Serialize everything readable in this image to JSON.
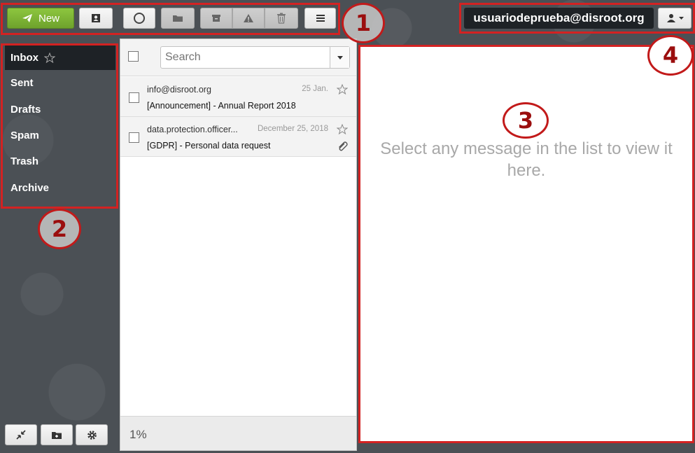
{
  "toolbar": {
    "new_label": "New"
  },
  "account": {
    "email": "usuariodeprueba@disroot.org"
  },
  "folders": [
    {
      "label": "Inbox",
      "active": true
    },
    {
      "label": "Sent"
    },
    {
      "label": "Drafts"
    },
    {
      "label": "Spam"
    },
    {
      "label": "Trash"
    },
    {
      "label": "Archive"
    }
  ],
  "search": {
    "placeholder": "Search"
  },
  "messages": [
    {
      "from": "info@disroot.org",
      "date": "25 Jan.",
      "subject": "[Announcement] - Annual Report 2018",
      "attachment": false
    },
    {
      "from": "data.protection.officer...",
      "date": "December 25, 2018",
      "subject": "[GDPR] - Personal data request",
      "attachment": true
    }
  ],
  "preview": {
    "empty_text": "Select any message in the list to view it here."
  },
  "footer": {
    "quota": "1%"
  },
  "annotations": [
    "1",
    "2",
    "3",
    "4"
  ],
  "colors": {
    "accent_green": "#7db436",
    "annotation_red": "#d32222",
    "sidebar_active": "#1e2226"
  }
}
